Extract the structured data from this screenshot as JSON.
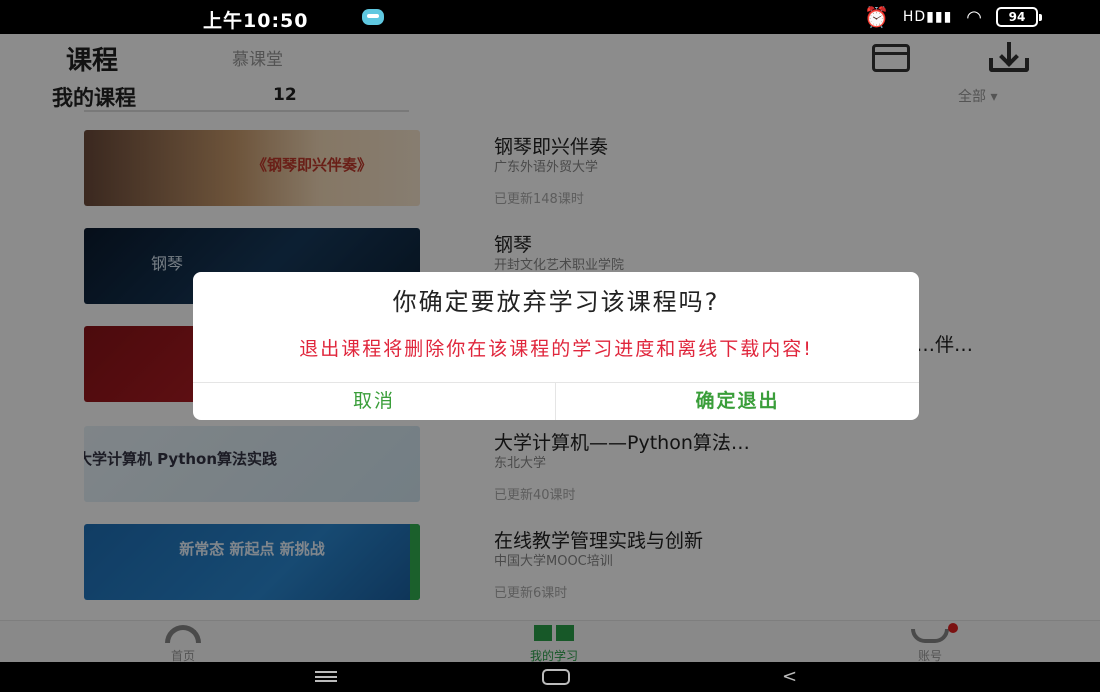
{
  "status_bar": {
    "time": "上午10:50",
    "battery": "94",
    "signal": "HD",
    "icons": [
      "chat-notification-icon",
      "alarm-icon",
      "signal-icon",
      "wifi-icon",
      "battery-icon"
    ]
  },
  "header": {
    "tab_course": "课程",
    "tab_mooc": "慕课堂",
    "icons": [
      "calendar-icon",
      "download-icon"
    ]
  },
  "section": {
    "title": "我的课程",
    "count": "12",
    "filter": "全部 ▾"
  },
  "courses": [
    {
      "title": "钢琴即兴伴奏",
      "school": "广东外语外贸大学",
      "updated": "已更新148课时",
      "thumb_text": "《钢琴即兴伴奏》"
    },
    {
      "title": "钢琴",
      "school": "开封文化艺术职业学院",
      "updated": "",
      "thumb_text": "钢琴"
    },
    {
      "title": "…伴…",
      "school": "",
      "updated": "",
      "thumb_text": ""
    },
    {
      "title": "大学计算机——Python算法…",
      "school": "东北大学",
      "updated": "已更新40课时",
      "thumb_text": "大学计算机 Python算法实践"
    },
    {
      "title": "在线教学管理实践与创新",
      "school": "中国大学MOOC培训",
      "updated": "已更新6课时",
      "thumb_text": "新常态 新起点 新挑战"
    }
  ],
  "bottom_nav": {
    "home": "首页",
    "learn": "我的学习",
    "account": "账号"
  },
  "dialog": {
    "title": "你确定要放弃学习该课程吗?",
    "message": "退出课程将删除你在该课程的学习进度和离线下载内容!",
    "cancel": "取消",
    "confirm": "确定退出"
  },
  "colors": {
    "accent_green": "#3a9e3a",
    "warning_red": "#e0263c"
  }
}
